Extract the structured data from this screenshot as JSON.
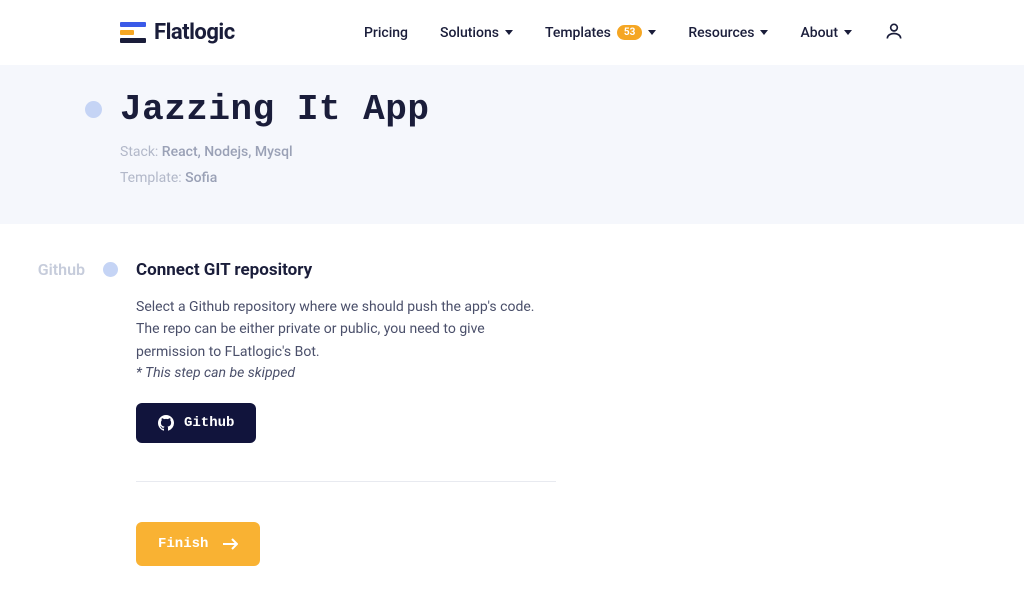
{
  "brand": {
    "name": "Flatlogic"
  },
  "nav": {
    "pricing": "Pricing",
    "solutions": "Solutions",
    "templates": "Templates",
    "templates_badge": "53",
    "resources": "Resources",
    "about": "About"
  },
  "hero": {
    "title": "Jazzing It App",
    "stack_label": "Stack: ",
    "stack_value": "React, Nodejs, Mysql",
    "template_label": "Template: ",
    "template_value": "Sofia"
  },
  "step": {
    "side_label": "Github",
    "title": "Connect GIT repository",
    "description": "Select a Github repository where we should push the app's code. The repo can be either private or public, you need to give permission to FLatlogic's Bot.",
    "note": "* This step can be skipped",
    "github_btn": "Github",
    "finish_btn": "Finish"
  }
}
